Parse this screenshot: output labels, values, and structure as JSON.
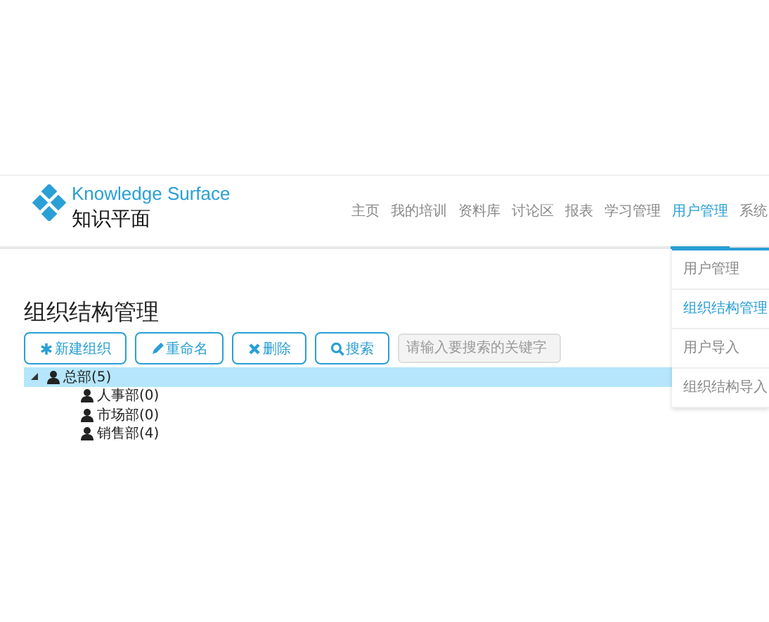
{
  "logo": {
    "title": "Knowledge Surface",
    "subtitle": "知识平面"
  },
  "nav": [
    {
      "label": "主页",
      "selected": false
    },
    {
      "label": "我的培训",
      "selected": false
    },
    {
      "label": "资料库",
      "selected": false
    },
    {
      "label": "讨论区",
      "selected": false
    },
    {
      "label": "报表",
      "selected": false
    },
    {
      "label": "学习管理",
      "selected": false
    },
    {
      "label": "用户管理",
      "selected": true
    },
    {
      "label": "系统",
      "selected": false
    }
  ],
  "dropdown": [
    {
      "label": "用户管理",
      "selected": false
    },
    {
      "label": "组织结构管理",
      "selected": true
    },
    {
      "label": "用户导入",
      "selected": false
    },
    {
      "label": "组织结构导入",
      "selected": false
    }
  ],
  "page_title": "组织结构管理",
  "toolbar": [
    {
      "kind": "add",
      "label": "新建组织"
    },
    {
      "kind": "edit",
      "label": "重命名"
    },
    {
      "kind": "delete",
      "label": "删除"
    },
    {
      "kind": "search",
      "label": "搜索"
    }
  ],
  "search": {
    "placeholder": "请输入要搜索的关键字"
  },
  "tree": [
    {
      "label": "总部(5)",
      "selected": true,
      "expanded": true,
      "children": [
        {
          "label": "人事部(0)",
          "selected": false
        },
        {
          "label": "市场部(0)",
          "selected": false
        },
        {
          "label": "销售部(4)",
          "selected": false
        }
      ]
    }
  ]
}
